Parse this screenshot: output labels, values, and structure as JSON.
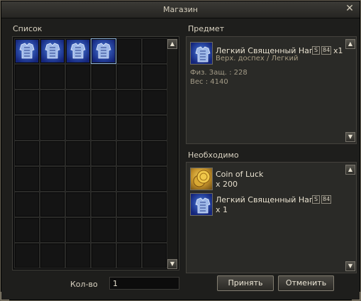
{
  "window": {
    "title": "Магазин"
  },
  "list": {
    "label": "Список",
    "rows": 9,
    "cols": 6,
    "items": [
      {
        "name": "Легкий Священный Нагрудник",
        "icon": "armor-icon",
        "selected": false
      },
      {
        "name": "Легкий Священный Нагрудник",
        "icon": "armor-icon",
        "selected": false
      },
      {
        "name": "Легкий Священный Нагрудник",
        "icon": "armor-icon",
        "selected": false
      },
      {
        "name": "Легкий Священный Нагрудник",
        "icon": "armor-icon",
        "selected": true
      }
    ]
  },
  "item_panel": {
    "label": "Предмет",
    "name": "Легкий Священный Наг..",
    "grade": "S",
    "grade_level": "84",
    "quantity": "x1",
    "type": "Верх. доспех / Легкий",
    "phys_def": "Физ. Защ. : 228",
    "weight": "Вес : 4140"
  },
  "required_panel": {
    "label": "Необходимо",
    "items": [
      {
        "name": "Coin of Luck",
        "quantity": "x 200",
        "icon": "coin-icon"
      },
      {
        "name": "Легкий Священный Наг..",
        "quantity": "x 1",
        "grade": "S",
        "grade_level": "84",
        "icon": "armor-icon"
      }
    ]
  },
  "footer": {
    "qty_label": "Кол-во",
    "qty_value": "1",
    "accept_label": "Принять",
    "cancel_label": "Отменить"
  },
  "colors": {
    "background": "#1e1e1c",
    "panel": "#2a2a27",
    "accent_text": "#a89d84"
  }
}
